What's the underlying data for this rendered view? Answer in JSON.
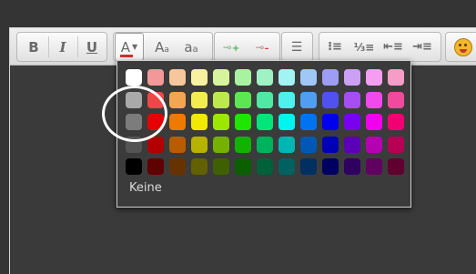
{
  "toolbar": {
    "bold_label": "B",
    "italic_label": "I",
    "underline_label": "U",
    "font_color_label": "A",
    "font_size_label": "A",
    "font_size_sub": "a",
    "font_face_label": "a",
    "font_face_sub": "a",
    "link_icon": "link-icon",
    "unlink_icon": "unlink-icon",
    "align_icon": "align-left-icon",
    "bullets_icon": "bullet-list-icon",
    "numbers_icon": "numbered-list-icon",
    "outdent_icon": "outdent-icon",
    "indent_icon": "indent-icon",
    "smiley_icon": "emoticon-icon",
    "font_color_underline": "#d03030"
  },
  "palette": {
    "none_label": "Keine",
    "rows": [
      [
        "#ffffff",
        "#f39898",
        "#f6c79c",
        "#f8f2a0",
        "#d7f49c",
        "#a8f3a1",
        "#9ff2c4",
        "#a1f4f2",
        "#a0c8f6",
        "#9d9df4",
        "#cba0f5",
        "#f49df1",
        "#f59dc6"
      ],
      [
        "#a9a9a9",
        "#ef4747",
        "#f3a651",
        "#f3ec4f",
        "#bde84d",
        "#5ce652",
        "#4fe9a5",
        "#4ff0ee",
        "#4f9ef2",
        "#5151ef",
        "#a64ef1",
        "#f049ec",
        "#f04a9d"
      ],
      [
        "#7c7c7c",
        "#e60000",
        "#f07a00",
        "#f2e900",
        "#9de600",
        "#1ee600",
        "#00e67a",
        "#00f4f0",
        "#0074f0",
        "#0000ef",
        "#7a00f0",
        "#f000ec",
        "#f00072"
      ],
      [
        "#545454",
        "#b20000",
        "#b75c00",
        "#b7b100",
        "#75b100",
        "#13b100",
        "#00b25c",
        "#00b6b3",
        "#0058b5",
        "#0000b4",
        "#5c00b6",
        "#b500b1",
        "#b50056"
      ],
      [
        "#000000",
        "#600000",
        "#663300",
        "#626000",
        "#3f6000",
        "#0a6000",
        "#00603a",
        "#006160",
        "#002f62",
        "#000060",
        "#300060",
        "#600060",
        "#60002f"
      ]
    ]
  },
  "colors": {
    "background": "#343434",
    "palette_bg": "#3b3b3b",
    "highlight_ring": "#ffffff"
  }
}
